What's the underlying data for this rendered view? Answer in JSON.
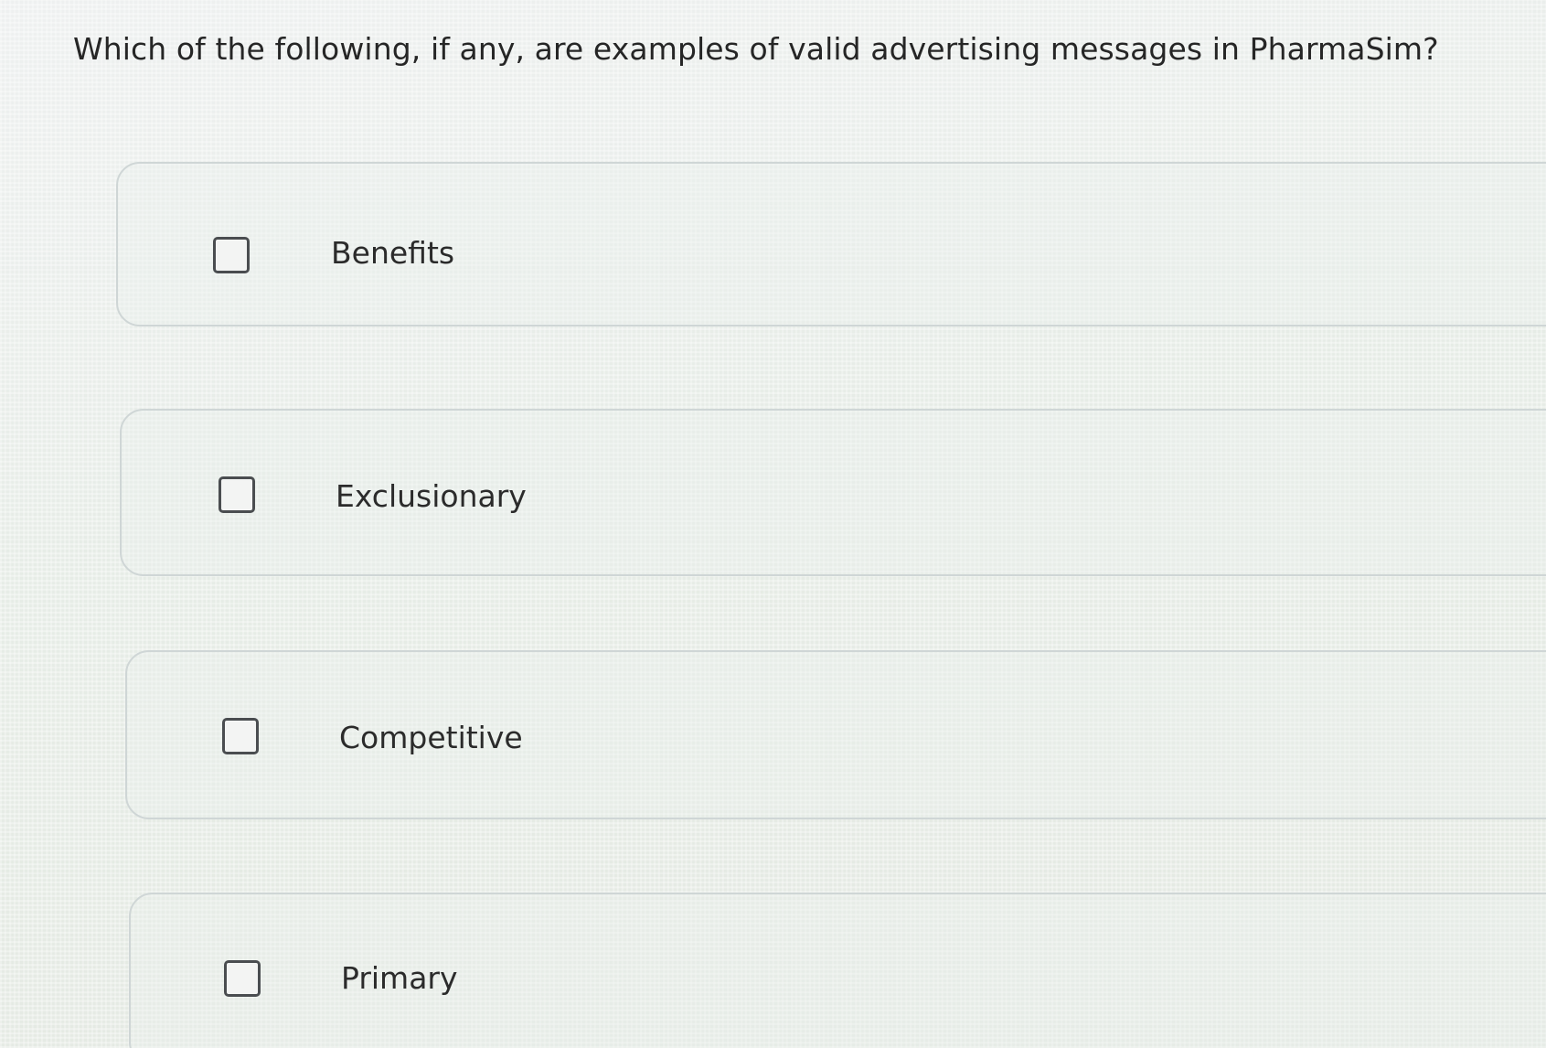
{
  "question": {
    "text": "Which of the following, if any, are examples of valid advertising messages in PharmaSim?"
  },
  "options": [
    {
      "label": "Benefits",
      "checked": false
    },
    {
      "label": "Exclusionary",
      "checked": false
    },
    {
      "label": "Competitive",
      "checked": false
    },
    {
      "label": "Primary",
      "checked": false
    }
  ],
  "colors": {
    "checkbox_border": "#4a4d50",
    "option_border": "#cfd6d6",
    "text": "#2b2b2b"
  }
}
